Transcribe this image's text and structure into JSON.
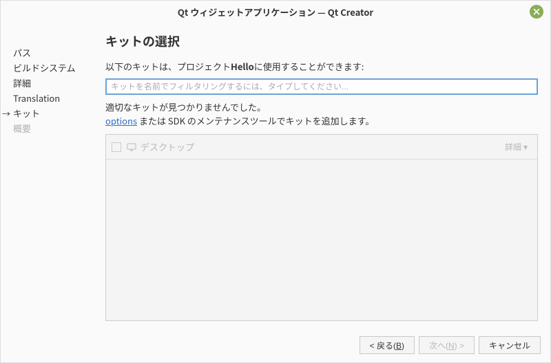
{
  "titlebar": {
    "text": "Qt ウィジェットアプリケーション — Qt Creator"
  },
  "sidebar": {
    "steps": {
      "path": "パス",
      "build": "ビルドシステム",
      "detail": "詳細",
      "translation": "Translation",
      "kit": "キット",
      "summary": "概要"
    }
  },
  "main": {
    "heading": "キットの選択",
    "instr_pre": "以下のキットは、プロジェクト",
    "instr_proj": "Hello",
    "instr_post": "に使用することができます:",
    "filter_placeholder": "キットを名前でフィルタリングするには、タイプしてください...",
    "warn_line1": "適切なキットが見つかりませんでした。",
    "warn_link": "options",
    "warn_line2_rest": " または SDK のメンテナンスツールでキットを追加します。",
    "kit0": {
      "label": "デスクトップ",
      "detail": "詳細"
    }
  },
  "footer": {
    "back": "< 戻る(",
    "back_key": "B",
    "back_end": ")",
    "next": "次へ(",
    "next_key": "N",
    "next_end": ") >",
    "cancel": "キャンセル"
  }
}
